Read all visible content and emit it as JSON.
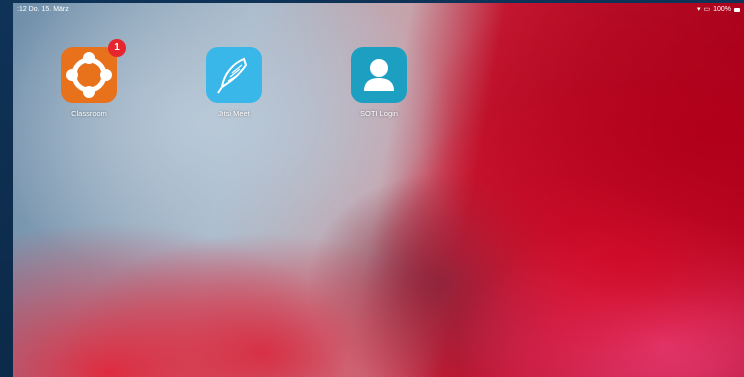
{
  "status_bar": {
    "time_date": ":12  Do. 15. März",
    "battery": "100%"
  },
  "apps": [
    {
      "label": "Classroom",
      "icon": "classroom-icon",
      "badge": "1",
      "color": "#e8711c"
    },
    {
      "label": "Jitsi Meet",
      "icon": "jitsi-meet-icon",
      "color": "#39b7e8"
    },
    {
      "label": "SOTI Login",
      "icon": "soti-login-icon",
      "color": "#1c9fc0"
    }
  ],
  "colors": {
    "frame": "#0e2d4d",
    "badge": "#e6252e"
  }
}
